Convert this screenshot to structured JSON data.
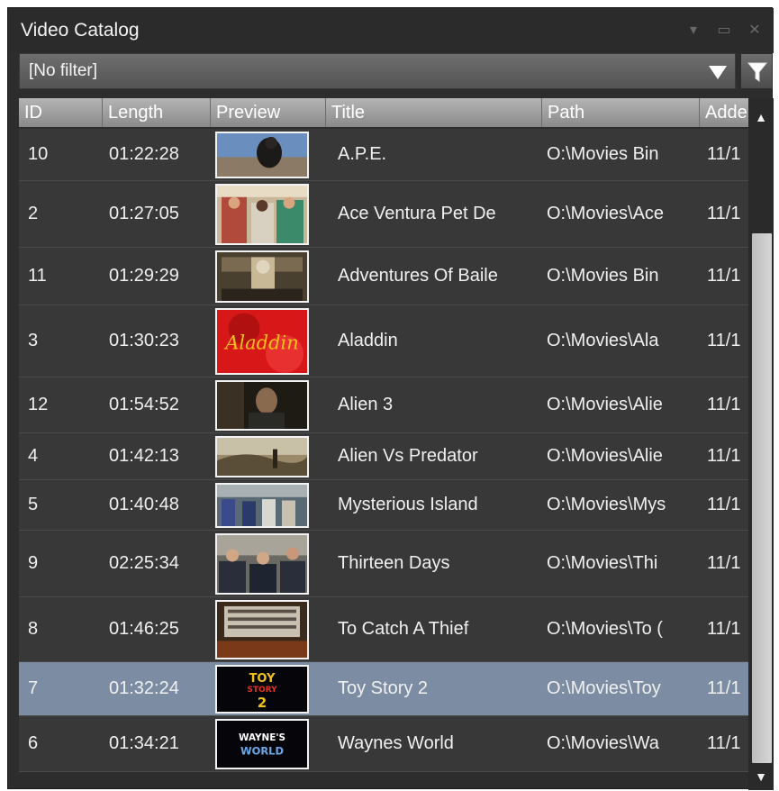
{
  "window": {
    "title": "Video Catalog"
  },
  "filter": {
    "selected": "[No filter]"
  },
  "columns": [
    "ID",
    "Length",
    "Preview",
    "Title",
    "Path",
    "Adde"
  ],
  "rows": [
    {
      "id": "10",
      "length": "01:22:28",
      "title": "A.P.E.",
      "path": "O:\\Movies Bin",
      "added": "11/1",
      "preview": "ape"
    },
    {
      "id": "2",
      "length": "01:27:05",
      "title": "Ace Ventura Pet De",
      "path": "O:\\Movies\\Ace",
      "added": "11/1",
      "preview": "ace-ventura"
    },
    {
      "id": "11",
      "length": "01:29:29",
      "title": "Adventures Of Baile",
      "path": "O:\\Movies Bin",
      "added": "11/1",
      "preview": "bailey"
    },
    {
      "id": "3",
      "length": "01:30:23",
      "title": "Aladdin",
      "path": "O:\\Movies\\Ala",
      "added": "11/1",
      "preview": "aladdin",
      "preview_text": "Aladdin"
    },
    {
      "id": "12",
      "length": "01:54:52",
      "title": "Alien 3",
      "path": "O:\\Movies\\Alie",
      "added": "11/1",
      "preview": "alien3"
    },
    {
      "id": "4",
      "length": "01:42:13",
      "title": "Alien Vs Predator",
      "path": "O:\\Movies\\Alie",
      "added": "11/1",
      "preview": "avp"
    },
    {
      "id": "5",
      "length": "01:40:48",
      "title": "Mysterious Island",
      "path": "O:\\Movies\\Mys",
      "added": "11/1",
      "preview": "island"
    },
    {
      "id": "9",
      "length": "02:25:34",
      "title": "Thirteen Days",
      "path": "O:\\Movies\\Thi",
      "added": "11/1",
      "preview": "thirteen"
    },
    {
      "id": "8",
      "length": "01:46:25",
      "title": "To Catch A Thief",
      "path": "O:\\Movies\\To (",
      "added": "11/1",
      "preview": "thief"
    },
    {
      "id": "7",
      "length": "01:32:24",
      "title": "Toy Story 2",
      "path": "O:\\Movies\\Toy",
      "added": "11/1",
      "preview": "toy-story",
      "selected": true,
      "preview_text_1": "TOY",
      "preview_text_2": "STORY",
      "preview_text_3": "2"
    },
    {
      "id": "6",
      "length": "01:34:21",
      "title": "Waynes World",
      "path": "O:\\Movies\\Wa",
      "added": "11/1",
      "preview": "waynes",
      "preview_text_1": "WAYNE'S",
      "preview_text_2": "WORLD"
    }
  ],
  "colors": {
    "row_bg": "#383838",
    "selected_bg": "#7c8da3",
    "header_bg": "#9c9c9c"
  }
}
